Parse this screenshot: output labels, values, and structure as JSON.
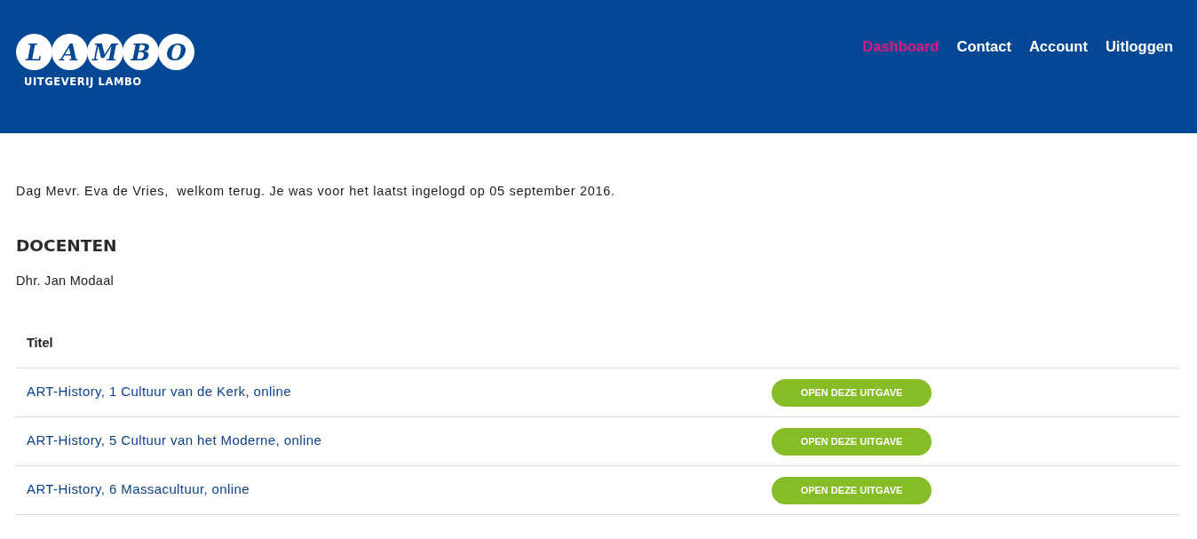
{
  "header": {
    "logo": {
      "letters": [
        "L",
        "A",
        "M",
        "B",
        "O"
      ],
      "caption": "UITGEVERIJ LAMBO"
    },
    "nav": [
      {
        "label": "Dashboard",
        "selected": true
      },
      {
        "label": "Contact",
        "selected": false
      },
      {
        "label": "Account",
        "selected": false
      },
      {
        "label": "Uitloggen",
        "selected": false
      }
    ]
  },
  "greeting": "Dag Mevr. Eva de Vries,  welkom terug. Je was voor het laatst ingelogd op 05 september 2016.",
  "section": {
    "title": "DOCENTEN",
    "teacher": "Dhr. Jan Modaal"
  },
  "table": {
    "columns": [
      "Titel"
    ],
    "rows": [
      {
        "title": "ART-History, 1 Cultuur van de Kerk, online",
        "button": "OPEN DEZE UITGAVE"
      },
      {
        "title": "ART-History, 5 Cultuur van het Moderne, online",
        "button": "OPEN DEZE UITGAVE"
      },
      {
        "title": "ART-History, 6 Massacultuur, online",
        "button": "OPEN DEZE UITGAVE"
      }
    ]
  }
}
